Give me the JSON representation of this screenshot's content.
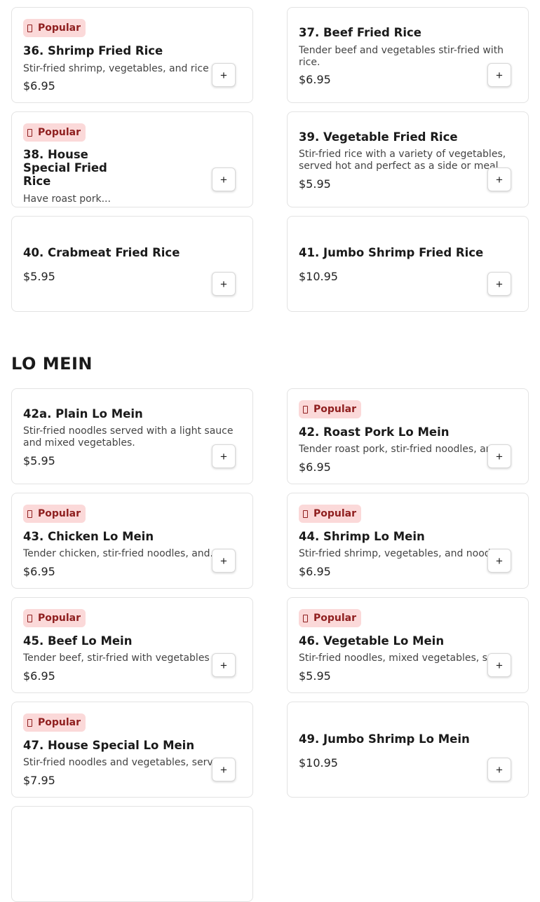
{
  "badge_label": "Popular",
  "add_label": "+",
  "section": {
    "title": "LO MEIN"
  },
  "cards": {
    "c36": {
      "title": "36. Shrimp Fried Rice",
      "desc": "Stir-fried shrimp, vegetables, and rice",
      "price": "$6.95",
      "popular": true
    },
    "c37": {
      "title": "37. Beef Fried Rice",
      "desc": "Tender beef and vegetables stir-fried with rice.",
      "price": "$6.95",
      "popular": false
    },
    "c38": {
      "title": "38. House Special Fried Rice",
      "desc": "Have roast pork...",
      "popular": true
    },
    "c39": {
      "title": "39. Vegetable Fried Rice",
      "desc": "Stir-fried rice with a variety of vegetables, served hot and perfect as a side or meal.",
      "price": "$5.95",
      "popular": false
    },
    "c40": {
      "title": "40. Crabmeat Fried Rice",
      "price": "$5.95",
      "popular": false
    },
    "c41": {
      "title": "41. Jumbo Shrimp Fried Rice",
      "price": "$10.95",
      "popular": false
    },
    "c42a": {
      "title": "42a. Plain Lo Mein",
      "desc": "Stir-fried noodles served with a light sauce and mixed vegetables.",
      "price": "$5.95",
      "popular": false
    },
    "c42": {
      "title": "42. Roast Pork Lo Mein",
      "desc": "Tender roast pork, stir-fried noodles, an...",
      "price": "$6.95",
      "popular": true
    },
    "c43": {
      "title": "43. Chicken Lo Mein",
      "desc": "Tender chicken, stir-fried noodles, and...",
      "price": "$6.95",
      "popular": true
    },
    "c44": {
      "title": "44. Shrimp Lo Mein",
      "desc": "Stir-fried shrimp, vegetables, and noodles.",
      "price": "$6.95",
      "popular": true
    },
    "c45": {
      "title": "45. Beef Lo Mein",
      "desc": "Tender beef, stir-fried with vegetables a...",
      "price": "$6.95",
      "popular": true
    },
    "c46": {
      "title": "46. Vegetable Lo Mein",
      "desc": "Stir-fried noodles, mixed vegetables, s...",
      "price": "$5.95",
      "popular": true
    },
    "c47": {
      "title": "47. House Special Lo Mein",
      "desc": "Stir-fried noodles and vegetables, serv...",
      "price": "$7.95",
      "popular": true
    },
    "c49": {
      "title": "49. Jumbo Shrimp Lo Mein",
      "price": "$10.95",
      "popular": false
    }
  }
}
